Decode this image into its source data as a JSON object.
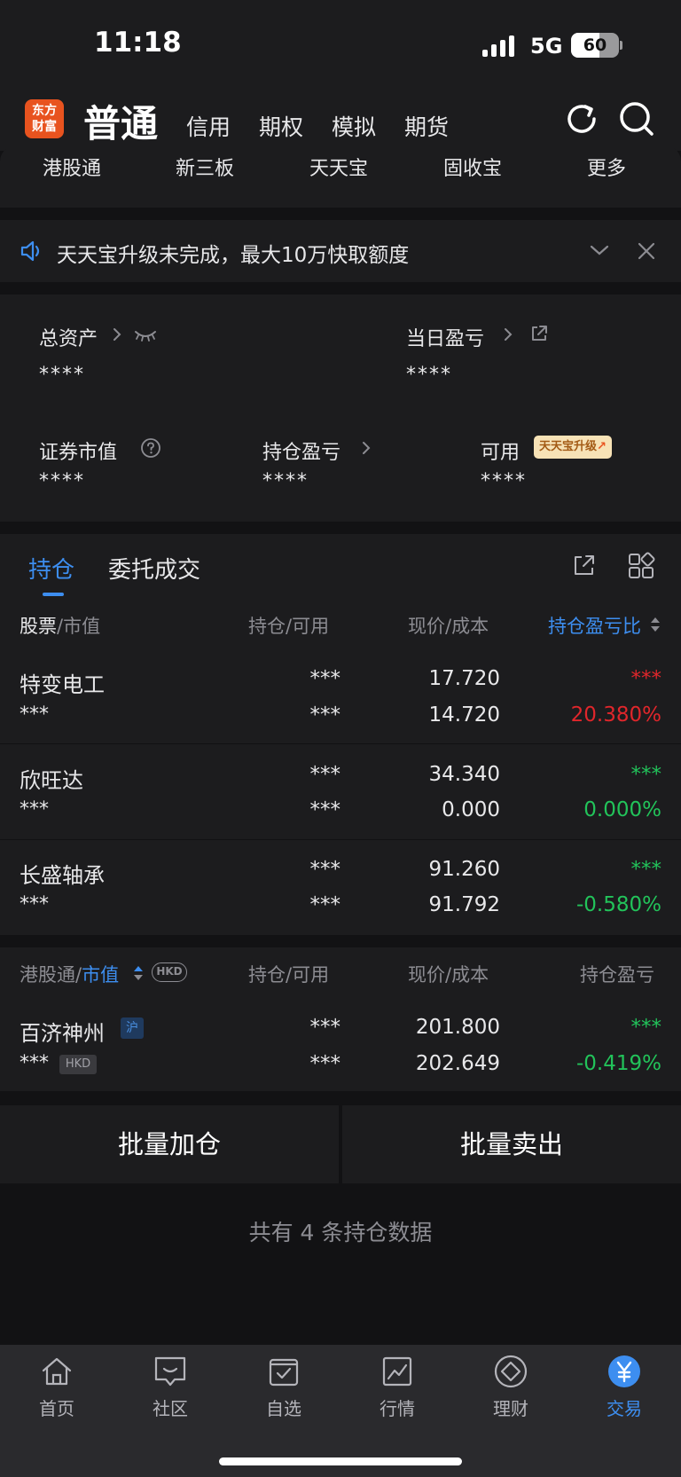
{
  "status_bar": {
    "time": "11:18",
    "network": "5G",
    "battery": "60",
    "battery_level": 0.6
  },
  "header": {
    "logo_line1": "东方",
    "logo_line2": "财富",
    "title": "普通",
    "tabs": [
      "信用",
      "期权",
      "模拟",
      "期货"
    ]
  },
  "subnav": [
    "港股通",
    "新三板",
    "天天宝",
    "固收宝",
    "更多"
  ],
  "notice": {
    "text": "天天宝升级未完成，最大10万快取额度"
  },
  "assets": {
    "total_assets_label": "总资产",
    "total_assets_value": "****",
    "daily_pl_label": "当日盈亏",
    "daily_pl_value": "****",
    "market_value_label": "证券市值",
    "market_value_value": "****",
    "position_pl_label": "持仓盈亏",
    "position_pl_value": "****",
    "available_label": "可用",
    "available_value": "****",
    "upgrade_badge": "天天宝升级"
  },
  "holdings_tabs": {
    "active": "持仓",
    "other": "委托成交"
  },
  "table": {
    "headers": {
      "stock": "股票",
      "market": "市值",
      "position": "持仓",
      "available": "可用",
      "price": "现价",
      "cost": "成本",
      "ratio": "持仓盈亏比"
    },
    "rows": [
      {
        "name": "特变电工",
        "mv": "***",
        "pos": "***",
        "avail": "***",
        "price": "17.720",
        "cost": "14.720",
        "pl": "***",
        "ratio": "20.380%"
      },
      {
        "name": "欣旺达",
        "mv": "***",
        "pos": "***",
        "avail": "***",
        "price": "34.340",
        "cost": "0.000",
        "pl": "***",
        "ratio": "0.000%"
      },
      {
        "name": "长盛轴承",
        "mv": "***",
        "pos": "***",
        "avail": "***",
        "price": "91.260",
        "cost": "91.792",
        "pl": "***",
        "ratio": "-0.580%"
      }
    ]
  },
  "hk_table": {
    "headers": {
      "stock": "港股通",
      "market": "市值",
      "currency": "HKD",
      "position": "持仓",
      "available": "可用",
      "price": "现价",
      "cost": "成本",
      "ratio": "持仓盈亏"
    },
    "rows": [
      {
        "name": "百济神州",
        "exchange": "沪",
        "mv": "***",
        "currency": "HKD",
        "pos": "***",
        "avail": "***",
        "price": "201.800",
        "cost": "202.649",
        "pl": "***",
        "ratio": "-0.419%"
      }
    ]
  },
  "actions": {
    "batch_add": "批量加仓",
    "batch_sell": "批量卖出"
  },
  "summary": {
    "text": "共有 4 条持仓数据"
  },
  "bottom_nav": [
    "首页",
    "社区",
    "自选",
    "行情",
    "理财",
    "交易"
  ],
  "colors": {
    "accent": "#3d8ef0",
    "up": "#e0262b",
    "down": "#22c35a",
    "brand": "#e8531f"
  }
}
